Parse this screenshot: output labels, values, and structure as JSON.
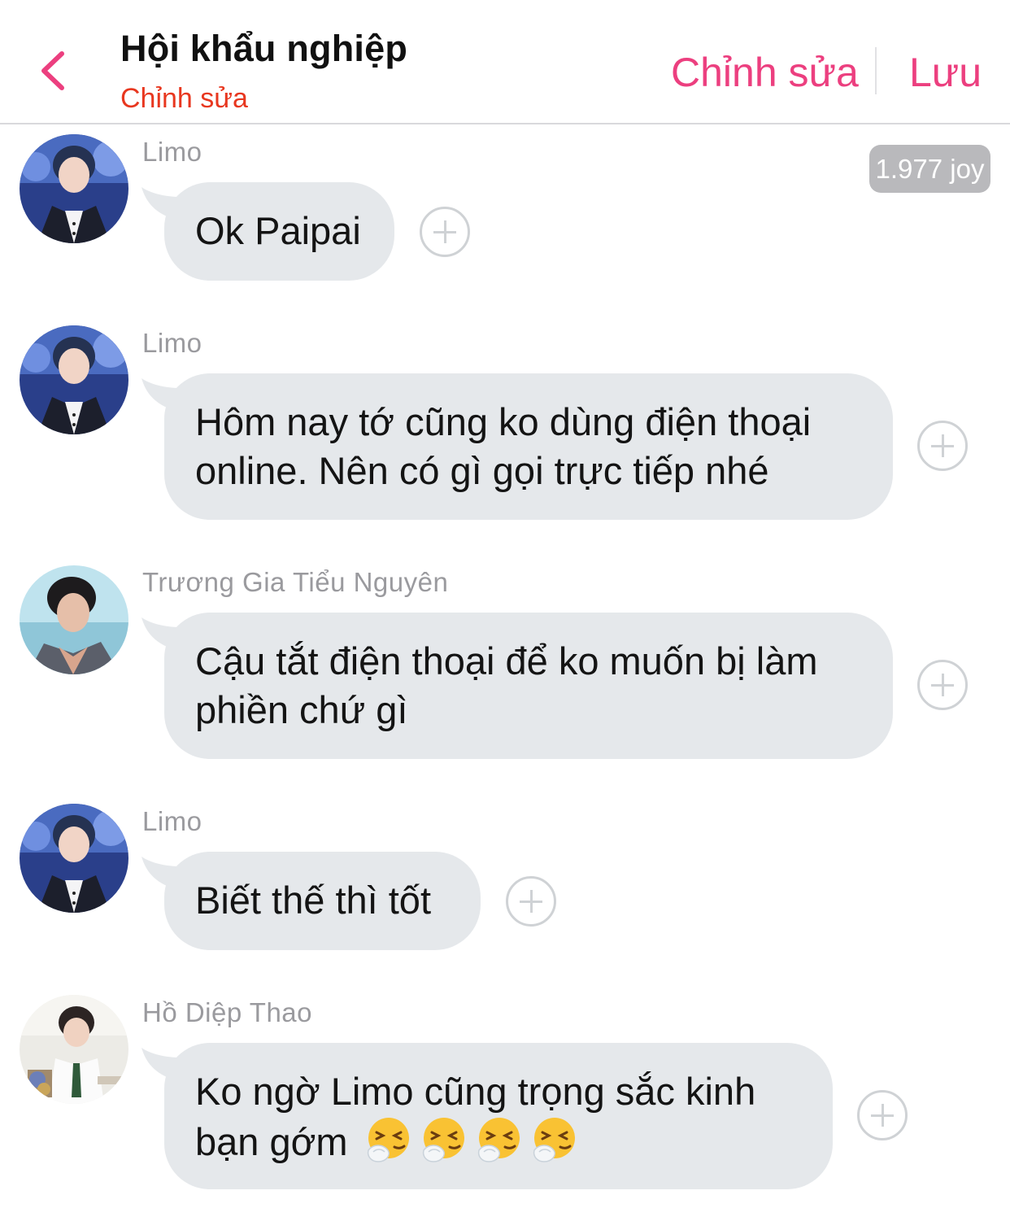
{
  "header": {
    "title": "Hội khẩu nghiệp",
    "subtitle": "Chỉnh sửa",
    "edit_label": "Chỉnh sửa",
    "save_label": "Lưu",
    "accent_color": "#ec3f7f",
    "subtitle_color": "#e8371f"
  },
  "messages": [
    {
      "sender": "Limo",
      "text": "Ok Paipai",
      "badge": "1.977 joy"
    },
    {
      "sender": "Limo",
      "text_line1": "Hôm nay tớ cũng ko dùng điện thoại",
      "text_line2": "online. Nên có gì gọi trực tiếp nhé"
    },
    {
      "sender": "Trương Gia Tiểu Nguyên",
      "text_line1": "Cậu tắt điện thoại để ko muốn bị làm",
      "text_line2": "phiền chứ gì"
    },
    {
      "sender": "Limo",
      "text": "Biết thế thì tốt"
    },
    {
      "sender": "Hồ Diệp Thao",
      "text_line1": "Ko ngờ Limo cũng trọng sắc kinh",
      "text_line2": "bạn gớm",
      "emoji": "sneezing-face",
      "emoji_count": 4
    }
  ],
  "colors": {
    "bubble": "#e5e8eb",
    "sender_text": "#9a9a9e",
    "plus_icon": "#cfd2d5"
  }
}
